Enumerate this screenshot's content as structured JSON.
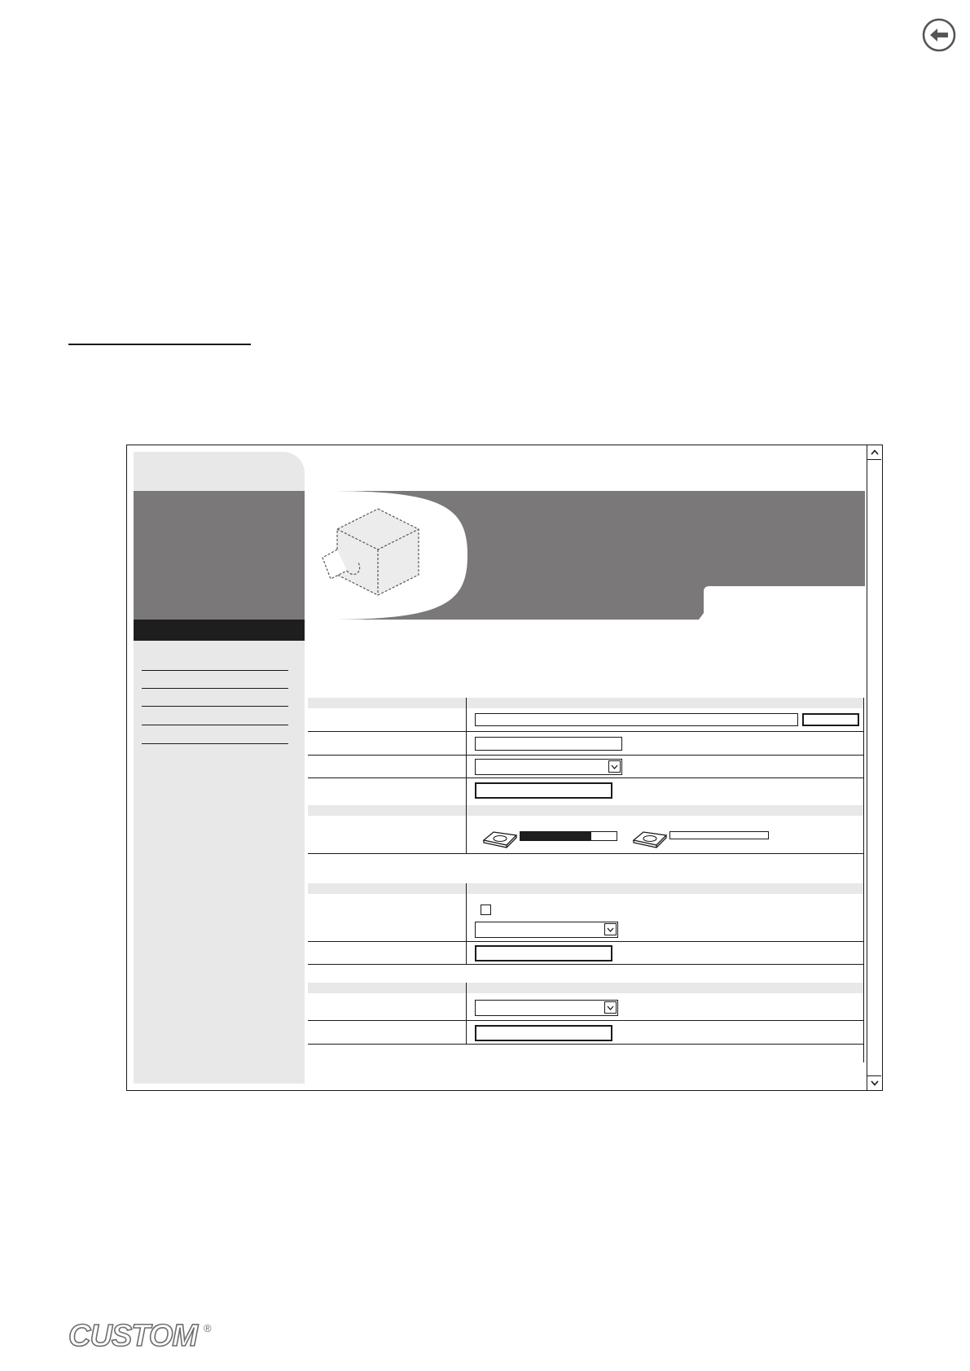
{
  "page": {
    "back_icon": "arrow-left-circle-icon"
  },
  "logo": {
    "text": "CUSTOM",
    "registered_mark": "®"
  },
  "window": {
    "scroll_up_icon": "chevron-up-icon",
    "scroll_down_icon": "chevron-down-icon",
    "banner_icon": "printer-icon",
    "colors": {
      "banner": "#7a7878",
      "sidebar": "#e8e8e8",
      "sidebar_bar": "#1e1e1e",
      "band": "#e8e8e8"
    },
    "nav_item_count_shown": 5
  },
  "storage": {
    "disks": [
      {
        "icon": "disk-drive-icon",
        "usage_fraction": 0.74
      },
      {
        "icon": "disk-drive-icon",
        "usage_fraction": 0.0
      }
    ]
  },
  "form": {
    "checkbox_checked": false
  }
}
